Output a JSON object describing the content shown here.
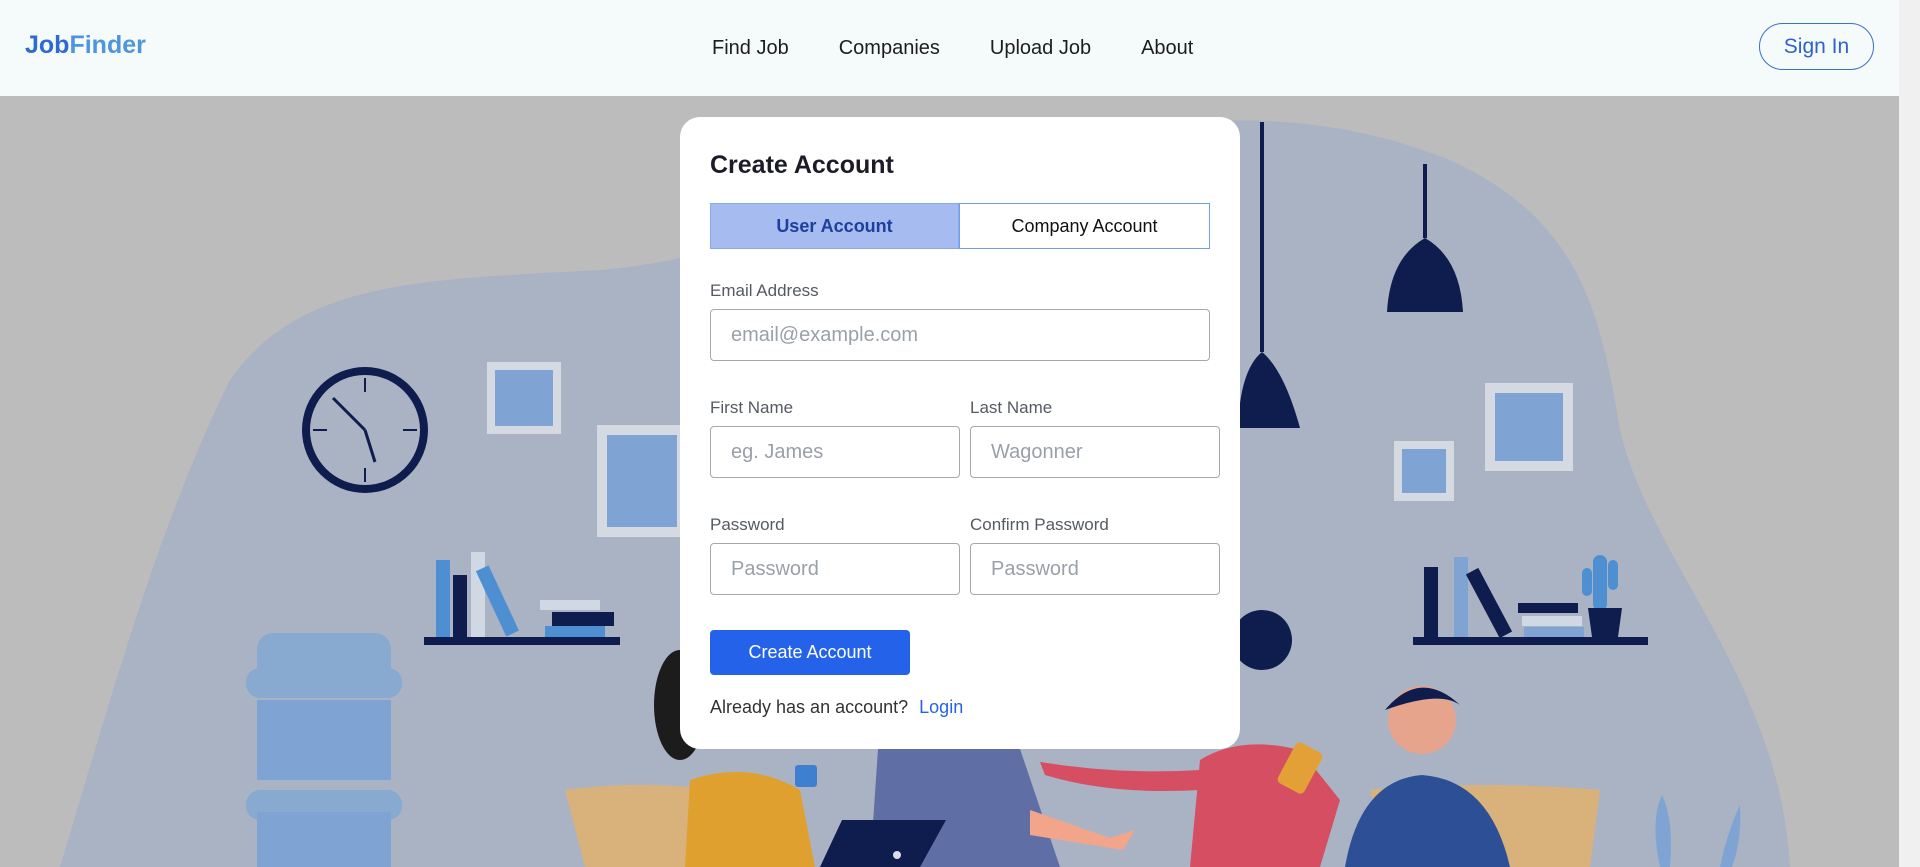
{
  "header": {
    "logo_part1": "Job",
    "logo_part2": "Finder",
    "nav": [
      "Find Job",
      "Companies",
      "Upload Job",
      "About"
    ],
    "sign_in": "Sign In"
  },
  "form": {
    "title": "Create Account",
    "tabs": [
      {
        "label": "User Account",
        "active": true
      },
      {
        "label": "Company Account",
        "active": false
      }
    ],
    "email": {
      "label": "Email Address",
      "placeholder": "email@example.com",
      "value": ""
    },
    "first_name": {
      "label": "First Name",
      "placeholder": "eg. James",
      "value": ""
    },
    "last_name": {
      "label": "Last Name",
      "placeholder": "Wagonner",
      "value": ""
    },
    "password": {
      "label": "Password",
      "placeholder": "Password",
      "value": ""
    },
    "confirm_password": {
      "label": "Confirm Password",
      "placeholder": "Password",
      "value": ""
    },
    "submit": "Create Account",
    "footer_text": "Already has an account?",
    "login_link": "Login"
  },
  "colors": {
    "primary": "#2463e9",
    "nav_bg": "#f5fafb",
    "backdrop": "#bcbcbc",
    "illustration_blob": "#aab3c4",
    "illustration_dark": "#0f1d4e",
    "illustration_accent": "#7fa4d3"
  },
  "icons": [
    "clock-icon",
    "lamp-icon",
    "bookshelf-icon",
    "water-cooler-icon",
    "cactus-icon"
  ]
}
